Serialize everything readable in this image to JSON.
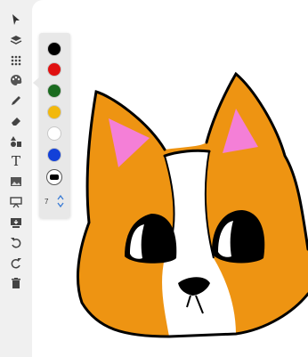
{
  "toolbar": {
    "tools": [
      {
        "name": "select-tool",
        "icon": "pointer-arrow-icon"
      },
      {
        "name": "layers-tool",
        "icon": "layers-icon"
      },
      {
        "name": "grid-tool",
        "icon": "dot-grid-icon"
      },
      {
        "name": "palette-tool",
        "icon": "palette-icon"
      },
      {
        "name": "pencil-tool",
        "icon": "pencil-icon"
      },
      {
        "name": "eraser-tool",
        "icon": "eraser-icon"
      },
      {
        "name": "shapes-tool",
        "icon": "shapes-icon"
      },
      {
        "name": "text-tool",
        "icon": "text-icon"
      },
      {
        "name": "image-tool",
        "icon": "image-icon"
      },
      {
        "name": "present-tool",
        "icon": "presentation-icon"
      },
      {
        "name": "download-tool",
        "icon": "download-icon"
      },
      {
        "name": "undo-tool",
        "icon": "undo-icon"
      },
      {
        "name": "redo-tool",
        "icon": "redo-icon"
      },
      {
        "name": "delete-tool",
        "icon": "trash-icon"
      }
    ],
    "text_tool_glyph": "T"
  },
  "palette": {
    "colors": [
      "#000000",
      "#e01010",
      "#1a6b1f",
      "#f2b80c",
      "#ffffff",
      "#1240d8"
    ],
    "stroke_size": "7"
  },
  "drawing": {
    "fill_orange": "#ee9412",
    "ear_pink": "#f47fd7",
    "outline": "#000000"
  }
}
